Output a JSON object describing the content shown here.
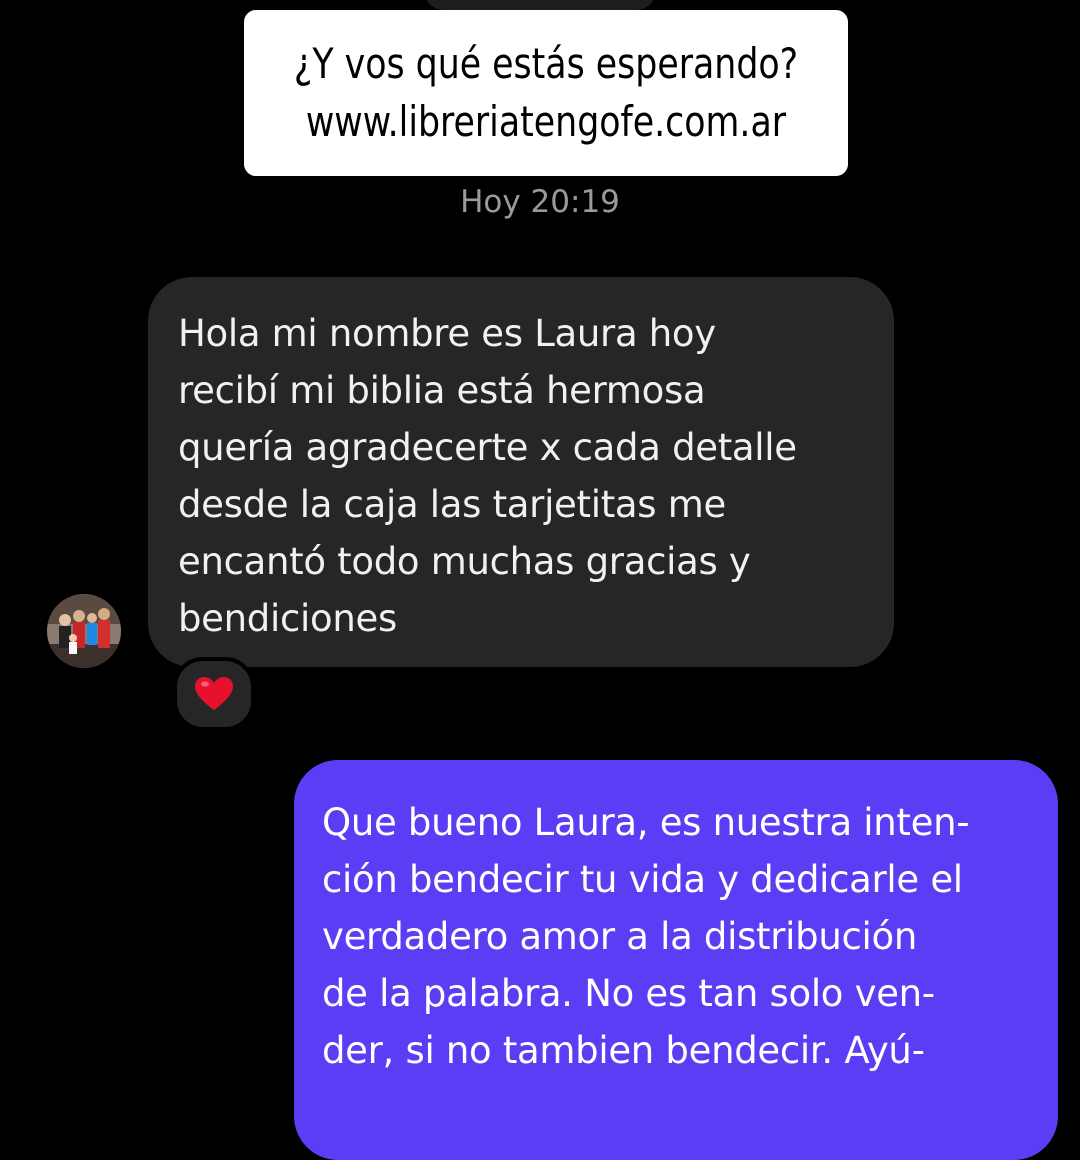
{
  "caption": {
    "line1": "¿Y vos qué estás esperando?",
    "line2": "www.libreriatengofe.com.ar"
  },
  "timestamp": "Hoy 20:19",
  "incoming": {
    "lines": [
      "Hola mi nombre es Laura hoy",
      "recibí mi biblia está hermosa",
      "quería agradecerte x cada detalle",
      "desde la caja las tarjetitas me",
      "encantó todo muchas gracias y",
      "bendiciones"
    ],
    "reaction": "heart-icon",
    "avatar": "avatar-icon"
  },
  "outgoing": {
    "lines": [
      "Que bueno Laura, es nuestra inten-",
      "ción bendecir tu vida y dedicarle el",
      "verdadero amor a la distribución",
      "de la palabra. No es tan solo ven-",
      "der, si no tambien bendecir. Ayú-"
    ]
  },
  "colors": {
    "background": "#000000",
    "incoming_bubble": "#262626",
    "outgoing_bubble": "#5b3df5",
    "reaction_heart": "#e8112d"
  }
}
